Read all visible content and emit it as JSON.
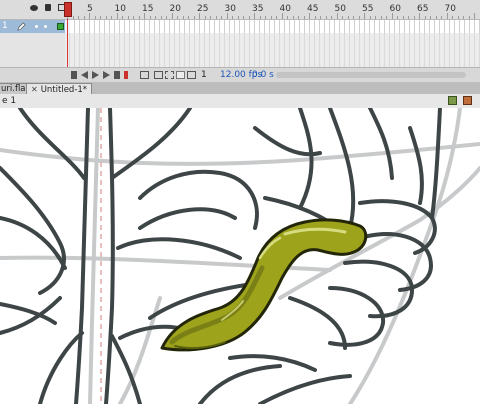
{
  "timeline": {
    "ruler_ticks": [
      "5",
      "10",
      "15",
      "20",
      "25",
      "30",
      "35",
      "40",
      "45",
      "50",
      "55",
      "60",
      "65",
      "70"
    ],
    "layer": {
      "number": "1"
    },
    "controls": {
      "current_frame": "1",
      "fps": "12.00 fps",
      "elapsed": "0.0 s"
    }
  },
  "tabs": [
    {
      "label": "uri.fla"
    },
    {
      "label": "Untitled-1*"
    }
  ],
  "editbar": {
    "scene": "e 1"
  },
  "colors": {
    "stroke_green": "#4d5e0e",
    "fill_olive": "#9ea31c",
    "highlight": "#d8dc80",
    "sketch_dark": "#3e4546",
    "sketch_light": "#c7c9ca",
    "playhead": "#c9312a"
  },
  "icons": [
    "eye-icon",
    "lock-icon",
    "outline-icon",
    "pencil-icon",
    "edit-scene-icon",
    "edit-symbol-icon"
  ]
}
